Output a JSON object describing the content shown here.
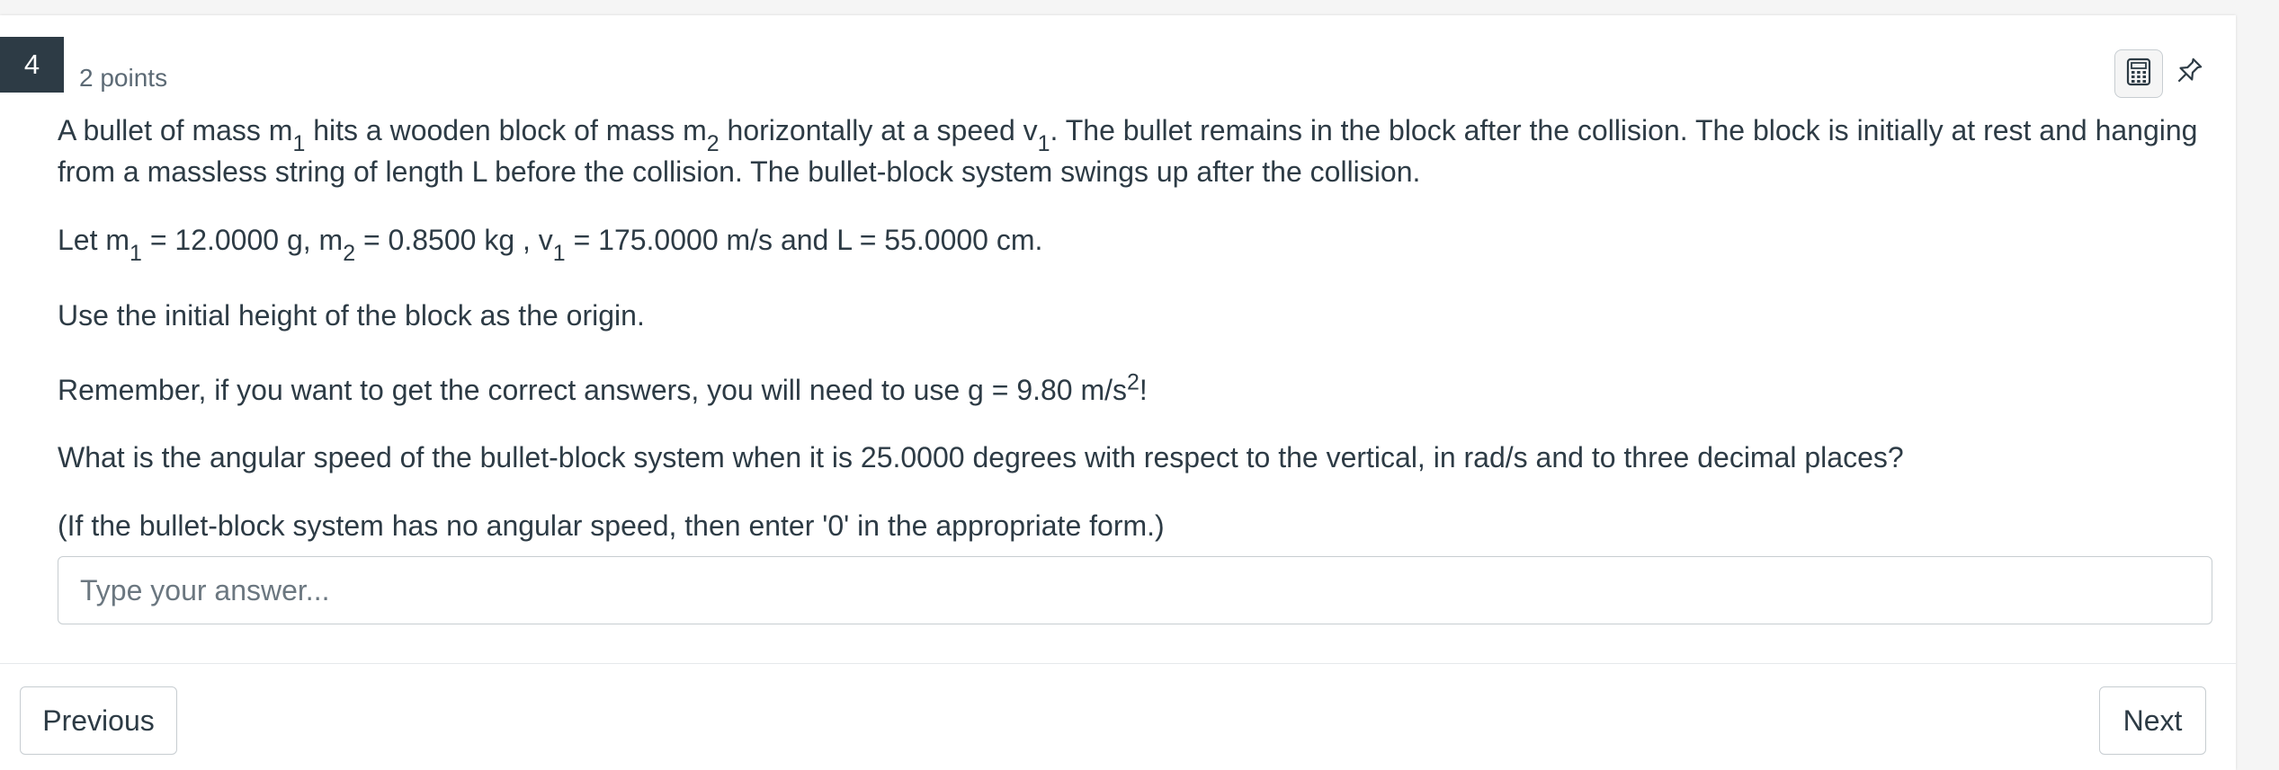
{
  "question": {
    "number": "4",
    "points": "2 points",
    "p1": {
      "a": "A bullet of mass m",
      "a_sub": "1",
      "b": " hits a wooden block of mass m",
      "b_sub": "2",
      "c": " horizontally at a speed v",
      "c_sub": "1",
      "d": ". The bullet remains in the block after the collision. The block is initially at rest and hanging from a massless string of length L before the collision. The bullet-block system swings up after the collision."
    },
    "p2": {
      "a": "Let m",
      "a_sub": "1",
      "b": " = 12.0000 g, m",
      "b_sub": "2",
      "c": " = 0.8500 kg , v",
      "c_sub": "1",
      "d": " = 175.0000 m/s and L = 55.0000 cm."
    },
    "p3": "Use the initial height of the block as the origin.",
    "p4": {
      "a": "Remember, if you want to get the correct answers, you will need to use g = 9.80 m/s",
      "a_sup": "2",
      "b": "!"
    },
    "p5": "What is the angular speed of the bullet-block system when it is 25.0000 degrees with respect to the vertical, in rad/s and to three decimal places?",
    "p6": "(If the bullet-block system has no angular speed, then enter '0' in the appropriate form.)",
    "answer_placeholder": "Type your answer...",
    "answer_value": ""
  },
  "toolbar": {
    "calculator_icon": "calculator-icon",
    "pin_icon": "pin-icon"
  },
  "nav": {
    "previous_label": "Previous",
    "next_label": "Next"
  }
}
